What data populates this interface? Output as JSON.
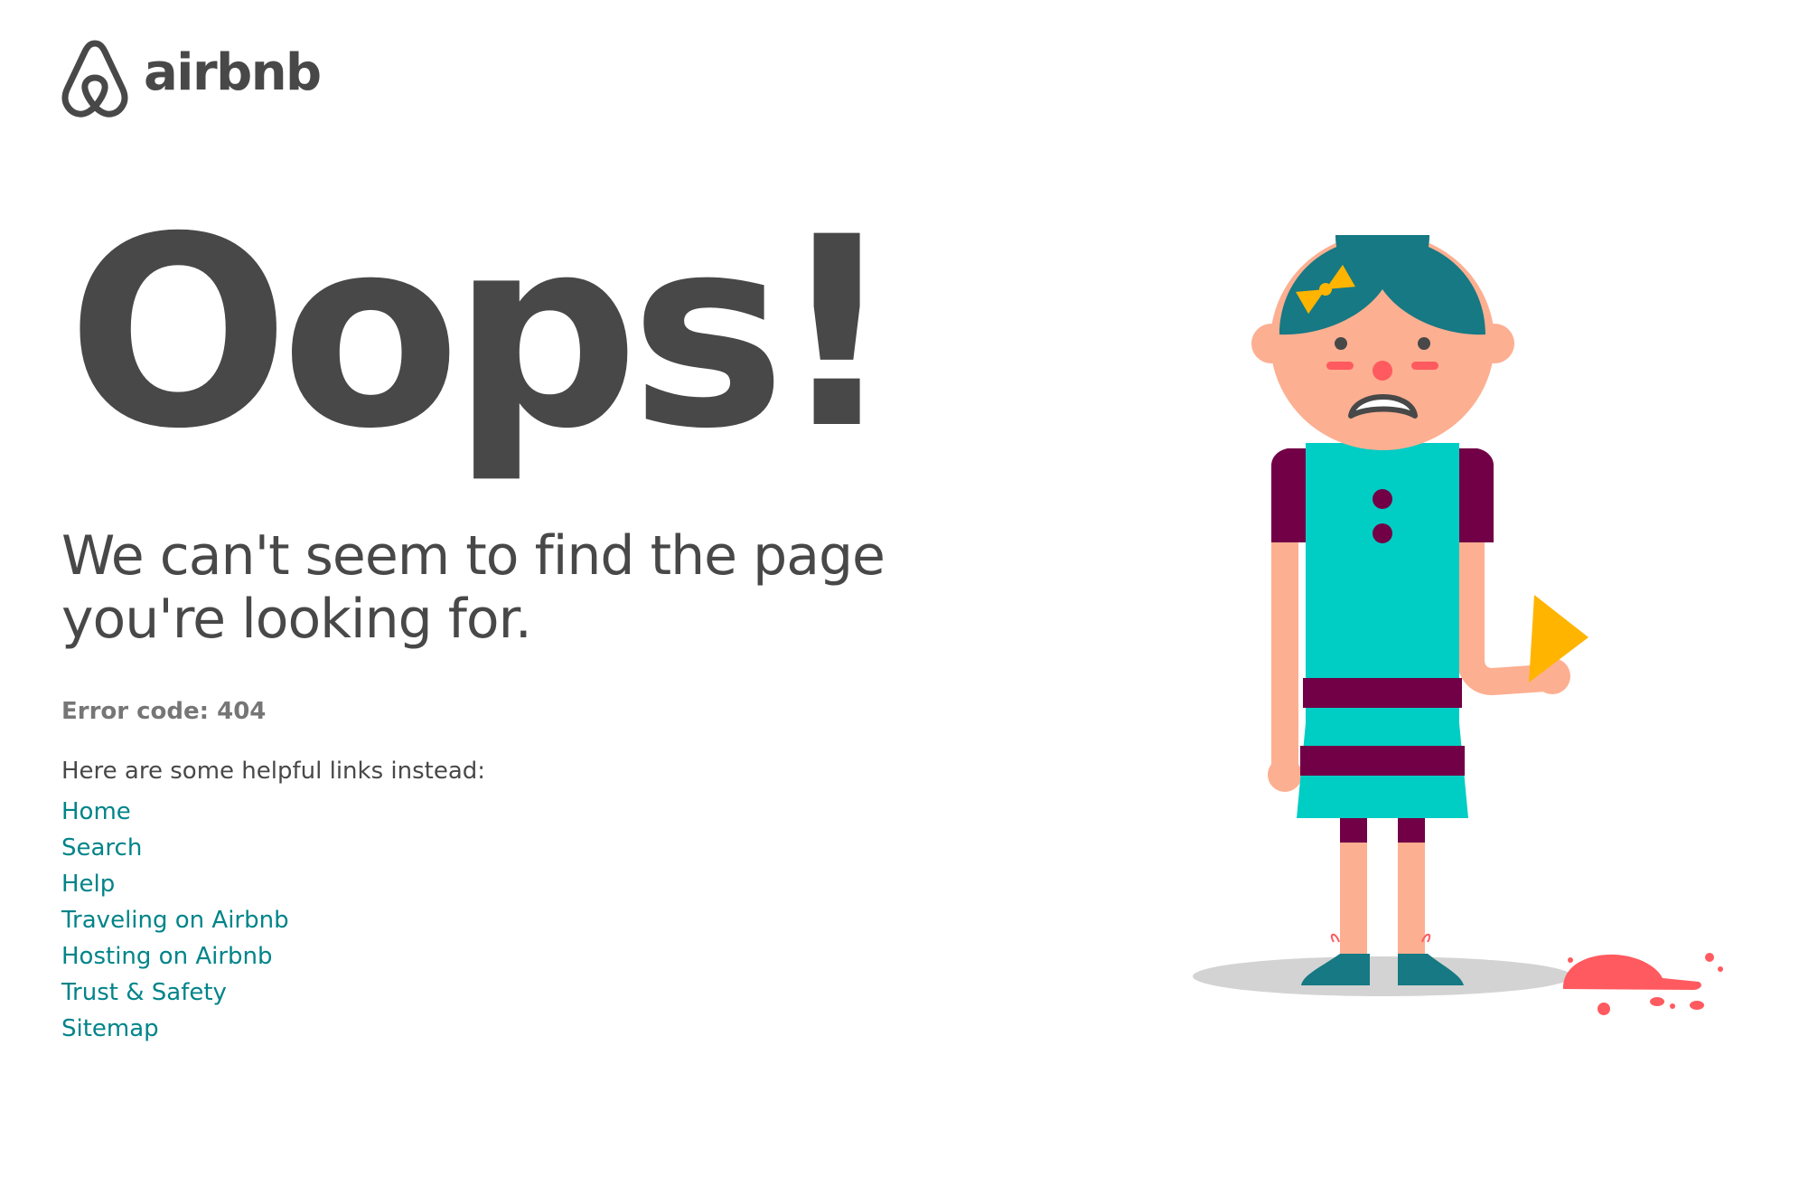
{
  "header": {
    "logo_text": "airbnb",
    "logo_icon": "airbnb-belo-icon"
  },
  "main": {
    "headline": "Oops!",
    "subtitle": "We can't seem to find the page you're looking for.",
    "error_code": "Error code: 404",
    "links_intro": "Here are some helpful links instead:",
    "links": [
      {
        "label": "Home"
      },
      {
        "label": "Search"
      },
      {
        "label": "Help"
      },
      {
        "label": "Traveling on Airbnb"
      },
      {
        "label": "Hosting on Airbnb"
      },
      {
        "label": "Trust & Safety"
      },
      {
        "label": "Sitemap"
      }
    ]
  },
  "illustration": {
    "description_icon": "sad-girl-dropped-ice-cream-illustration"
  },
  "colors": {
    "text_primary": "#484848",
    "text_secondary": "#767676",
    "link": "#008489",
    "hair": "#167983",
    "dress": "#00CDC4",
    "dress_stripes": "#720046",
    "skin": "#FDAF91",
    "cone": "#FFB400",
    "ice_cream": "#FF5A5F",
    "shadow": "#D3D3D3"
  }
}
